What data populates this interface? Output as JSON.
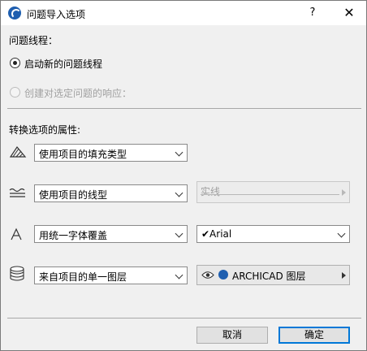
{
  "window": {
    "title": "问题导入选项",
    "help_glyph": "?",
    "close_glyph": "✕"
  },
  "thread_section": {
    "heading": "问题线程：",
    "option_new": "启动新的问题线程",
    "option_reply": "创建对选定问题的响应："
  },
  "attributes": {
    "heading": "转换选项的属性:",
    "fill": {
      "value": "使用项目的填充类型"
    },
    "line": {
      "value": "使用项目的线型",
      "line_type": "实线"
    },
    "font": {
      "value": "用统一字体覆盖",
      "font_name": "✔Arial"
    },
    "layer": {
      "value": "来自项目的单一图层",
      "layer_name": "ARCHICAD 图层"
    }
  },
  "buttons": {
    "cancel": "取消",
    "ok": "确定"
  }
}
